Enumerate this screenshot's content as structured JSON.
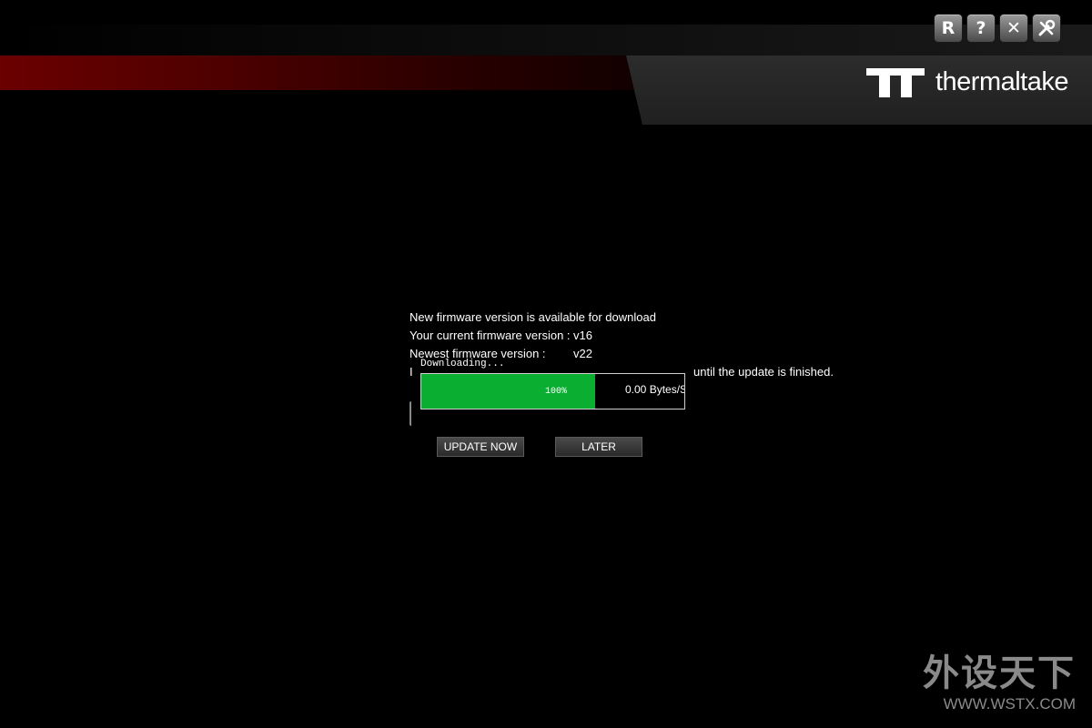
{
  "window_controls": [
    {
      "name": "reset-button",
      "label": "R"
    },
    {
      "name": "help-button",
      "label": "?"
    },
    {
      "name": "close-button",
      "label": "✕"
    },
    {
      "name": "settings-button",
      "icon": "tools-icon"
    }
  ],
  "brand": {
    "logo_text": "thermaltake",
    "logo_icon": "tt-logo-icon"
  },
  "firmware": {
    "heading": "New firmware version is available for download",
    "current_label": "Your current firmware version :",
    "current_value": "v16",
    "newest_label": "Newest firmware version :",
    "newest_value": "v22",
    "note_left": "I",
    "note_right": "until the update is finished."
  },
  "download": {
    "label": "Downloading...",
    "percent_text": "100%",
    "progress": 0.66,
    "speed": "0.00 Bytes/S",
    "bar_color": "#0aaf32"
  },
  "actions": {
    "update_now": "UPDATE NOW",
    "later": "LATER"
  },
  "watermark": {
    "cn": "外设天下",
    "url": "WWW.WSTX.COM"
  },
  "colors": {
    "accent_red": "#6a0000",
    "background": "#000000"
  }
}
